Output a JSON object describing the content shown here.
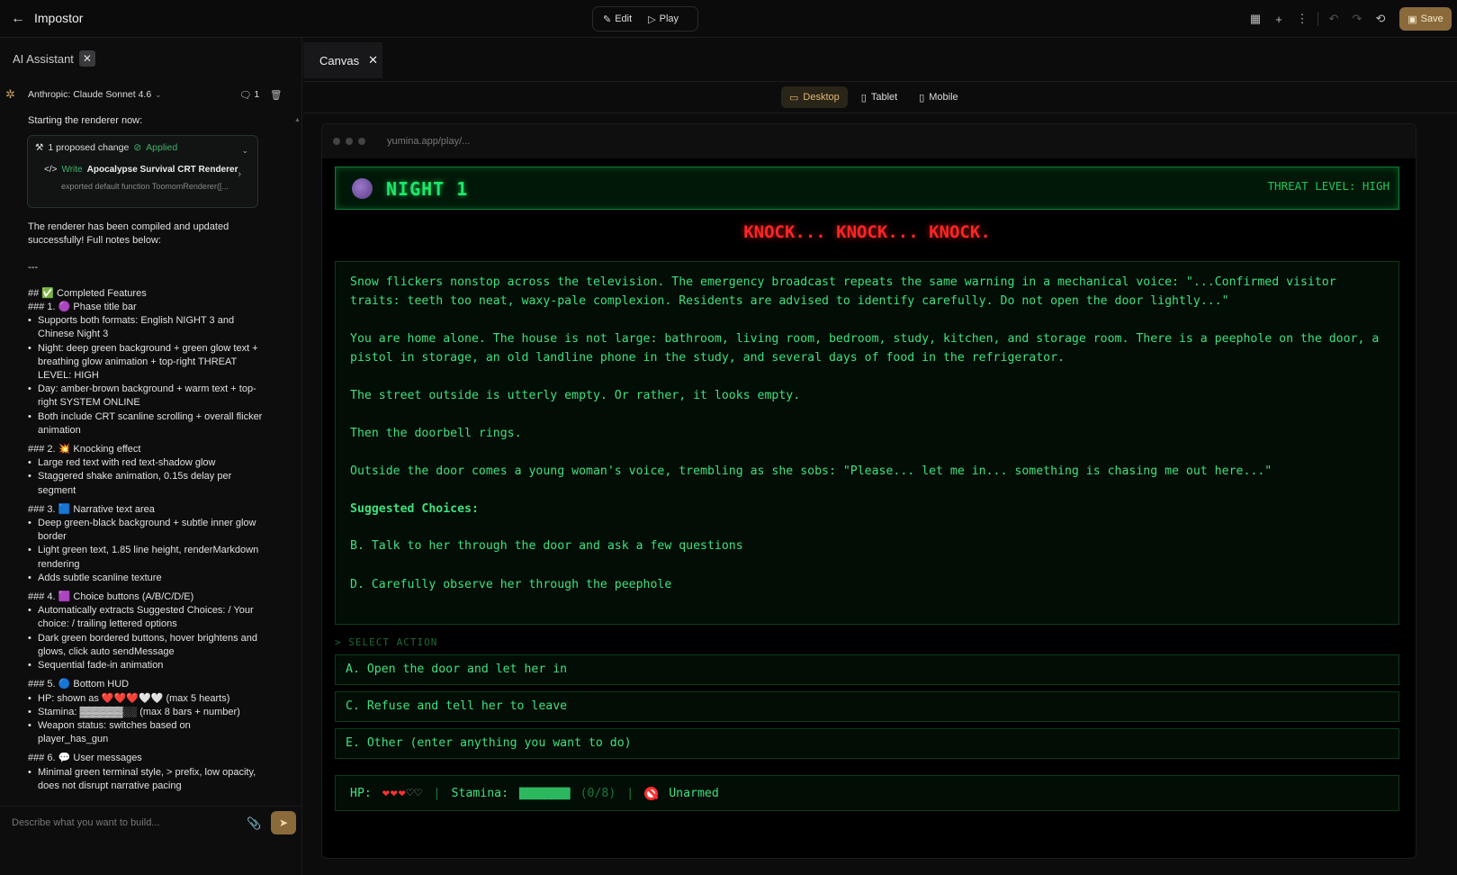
{
  "app": {
    "title": "Impostor",
    "back_icon": "arrow-left-icon"
  },
  "modes": {
    "edit": "Edit",
    "play": "Play"
  },
  "toolbar": {
    "save": "Save"
  },
  "left_tab": {
    "label": "AI Assistant"
  },
  "model": {
    "name": "Anthropic: Claude Sonnet 4.6",
    "message_count": "1"
  },
  "chat": {
    "intro": "Starting the renderer now:",
    "proposal": {
      "count_label": "1 proposed change",
      "status": "Applied",
      "write_label": "Write",
      "write_title": "Apocalypse Survival CRT Renderer",
      "write_sub": "exported default function ToomomRenderer([..."
    },
    "done": "The renderer has been compiled and updated successfully! Full notes below:",
    "divider": "---",
    "heading": "## ✅ Completed Features",
    "sections": [
      {
        "title": "### 1. 🟣 Phase title bar",
        "items": [
          "Supports both formats: English NIGHT 3 and Chinese Night 3",
          "Night: deep green background + green glow text + breathing glow animation + top-right THREAT LEVEL: HIGH",
          "Day: amber-brown background + warm text + top-right SYSTEM ONLINE",
          "Both include CRT scanline scrolling + overall flicker animation"
        ]
      },
      {
        "title": "### 2. 💥 Knocking effect",
        "items": [
          "Large red text with red text-shadow glow",
          "Staggered shake animation, 0.15s delay per segment"
        ]
      },
      {
        "title": "### 3. 🟦 Narrative text area",
        "items": [
          "Deep green-black background + subtle inner glow border",
          "Light green text, 1.85 line height, renderMarkdown rendering",
          "Adds subtle scanline texture"
        ]
      },
      {
        "title": "### 4. 🟪 Choice buttons (A/B/C/D/E)",
        "items": [
          "Automatically extracts Suggested Choices: / Your choice: / trailing lettered options",
          "Dark green bordered buttons, hover brightens and glows, click auto sendMessage",
          "Sequential fade-in animation"
        ]
      },
      {
        "title": "### 5. 🔵 Bottom HUD",
        "items": [
          "HP: shown as ❤️❤️❤️🤍🤍 (max 5 hearts)",
          "Stamina: ▓▓▓▓▓▓░░ (max 8 bars + number)",
          "Weapon status: switches based on player_has_gun"
        ]
      },
      {
        "title": "### 6. 💬 User messages",
        "items": [
          "Minimal green terminal style, > prefix, low opacity, does not disrupt narrative pacing"
        ]
      }
    ]
  },
  "input": {
    "placeholder": "Describe what you want to build..."
  },
  "canvas_tab": {
    "label": "Canvas"
  },
  "devices": {
    "desktop": "Desktop",
    "tablet": "Tablet",
    "mobile": "Mobile"
  },
  "browser": {
    "url": "yumina.app/play/..."
  },
  "game": {
    "phase": "NIGHT 1",
    "threat": "THREAT LEVEL: HIGH",
    "knock": "KNOCK... KNOCK... KNOCK.",
    "paragraphs": [
      "Snow flickers nonstop across the television. The emergency broadcast repeats the same warning in a mechanical voice: \"...Confirmed visitor traits: teeth too neat, waxy-pale complexion. Residents are advised to identify carefully. Do not open the door lightly...\"",
      "You are home alone. The house is not large: bathroom, living room, bedroom, study, kitchen, and storage room. There is a peephole on the door, a pistol in storage, an old landline phone in the study, and several days of food in the refrigerator.",
      "The street outside is utterly empty. Or rather, it looks empty.",
      "Then the doorbell rings.",
      "Outside the door comes a young woman's voice, trembling as she sobs: \"Please... let me in... something is chasing me out here...\""
    ],
    "suggested_label": "Suggested Choices:",
    "suggested": [
      "B.  Talk to her through the door and ask a few questions",
      "D.  Carefully observe her through the peephole"
    ],
    "select_action": "> SELECT ACTION",
    "choices": [
      "A.  Open the door and let her in",
      "C.  Refuse and tell her to leave",
      "E.  Other (enter anything you want to do)"
    ],
    "hud": {
      "hp_label": "HP:",
      "hp": 3,
      "hp_max": 5,
      "divider": "|",
      "stamina_label": "Stamina:",
      "stamina_bars": "▇▇▇▇▇▇▇▇",
      "stamina_value": "(0/8)",
      "weapon": "Unarmed"
    }
  }
}
